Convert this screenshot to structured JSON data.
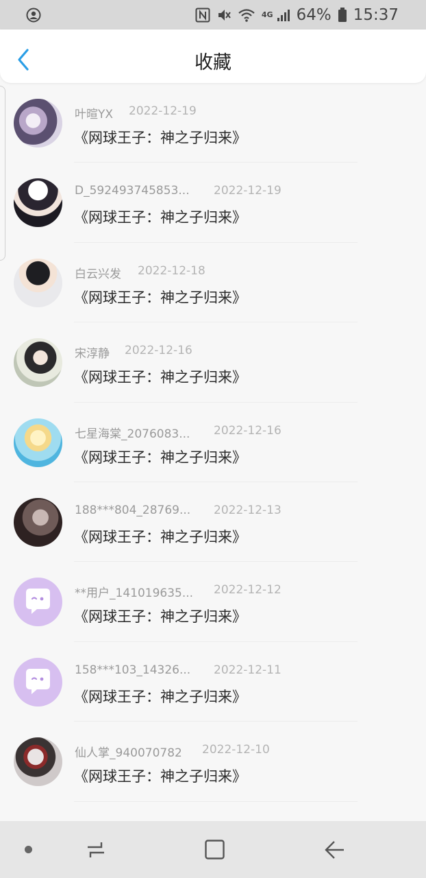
{
  "status_bar": {
    "battery_percent": "64%",
    "time": "15:37",
    "network": "4G"
  },
  "header": {
    "title": "收藏",
    "back_icon": "chevron-left-icon"
  },
  "colors": {
    "accent": "#2a9ee6",
    "generic_avatar": "#d7bff0"
  },
  "items": [
    {
      "name": "叶暄YX",
      "date": "2022-12-19",
      "book": "《网球王子：神之子归来》",
      "avatar": "anime-avatar"
    },
    {
      "name": "D_592493745853...",
      "date": "2022-12-19",
      "book": "《网球王子：神之子归来》",
      "avatar": "anime-avatar"
    },
    {
      "name": "白云兴发",
      "date": "2022-12-18",
      "book": "《网球王子：神之子归来》",
      "avatar": "anime-avatar"
    },
    {
      "name": "宋淳静",
      "date": "2022-12-16",
      "book": "《网球王子：神之子归来》",
      "avatar": "anime-avatar"
    },
    {
      "name": "七星海棠_2076083...",
      "date": "2022-12-16",
      "book": "《网球王子：神之子归来》",
      "avatar": "anime-avatar"
    },
    {
      "name": "188***804_28769...",
      "date": "2022-12-13",
      "book": "《网球王子：神之子归来》",
      "avatar": "anime-avatar"
    },
    {
      "name": "**用户_141019635...",
      "date": "2022-12-12",
      "book": "《网球王子：神之子归来》",
      "avatar": "default-chat-avatar"
    },
    {
      "name": "158***103_14326...",
      "date": "2022-12-11",
      "book": "《网球王子：神之子归来》",
      "avatar": "default-chat-avatar"
    },
    {
      "name": "仙人掌_940070782",
      "date": "2022-12-10",
      "book": "《网球王子：神之子归来》",
      "avatar": "anime-avatar"
    }
  ]
}
